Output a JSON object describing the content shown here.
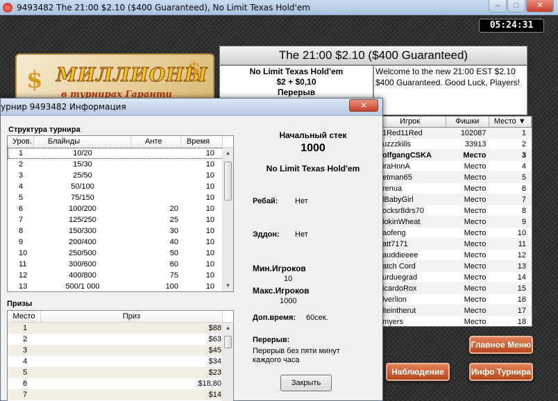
{
  "window": {
    "title": "9493482 The 21:00 $2.10 ($400 Guaranteed), No Limit Texas Hold'em",
    "minimize": "–",
    "maximize": "□",
    "close": "✕"
  },
  "clock": "05:24:31",
  "logo": {
    "main": "МИЛЛИОНЫ",
    "sub": "в турнирах Гаранти"
  },
  "tournament": {
    "header": "The 21:00 $2.10 ($400 Guaranteed)",
    "game": "No Limit Texas Hold'em",
    "buyin": "$2 + $0,10",
    "status": "Перерыв",
    "welcome": "Welcome to the new 21:00 EST $2.10 $400 Guaranteed. Good Luck, Players!"
  },
  "players": {
    "headers": {
      "name": "Игрок",
      "chips": "Фишки",
      "place": "Место ▼"
    },
    "rows": [
      {
        "name": "1Red11Red",
        "chips": "102087",
        "place": "1"
      },
      {
        "name": "uzzzkills",
        "chips": "33913",
        "place": "2"
      },
      {
        "name": "olfgangCSKA",
        "chips": "Место",
        "place": "3"
      },
      {
        "name": "iraHnnA",
        "chips": "Место",
        "place": "4"
      },
      {
        "name": "etman65",
        "chips": "Место",
        "place": "5"
      },
      {
        "name": "renua",
        "chips": "Место",
        "place": "6"
      },
      {
        "name": "lBabyGirl",
        "chips": "Место",
        "place": "7"
      },
      {
        "name": "ocksr8drs70",
        "chips": "Место",
        "place": "8"
      },
      {
        "name": "lokinWheat",
        "chips": "Место",
        "place": "9"
      },
      {
        "name": "aofeng",
        "chips": "Место",
        "place": "10"
      },
      {
        "name": "att7171",
        "chips": "Место",
        "place": "11"
      },
      {
        "name": "auddieeee",
        "chips": "Место",
        "place": "12"
      },
      {
        "name": "atch Cord",
        "chips": "Место",
        "place": "13"
      },
      {
        "name": "urduegrad",
        "chips": "Место",
        "place": "14"
      },
      {
        "name": "icardoRox",
        "chips": "Место",
        "place": "15"
      },
      {
        "name": "lverlion",
        "chips": "Место",
        "place": "16"
      },
      {
        "name": "lteintherut",
        "chips": "Место",
        "place": "17"
      },
      {
        "name": "myers",
        "chips": "Место",
        "place": "18"
      }
    ]
  },
  "buttons": {
    "main_menu": "Главное Меню",
    "observe": "Наблюдение",
    "tourney_info": "Инфо Турнира"
  },
  "dialog": {
    "title": "урнир 9493482 Информация",
    "close_icon": "✕",
    "structure": {
      "title": "Структура турнира",
      "headers": {
        "level": "Уров.",
        "blinds": "Блайнды",
        "ante": "Анте",
        "time": "Время"
      },
      "rows": [
        {
          "level": "1",
          "blinds": "10/20",
          "ante": "",
          "time": "10"
        },
        {
          "level": "2",
          "blinds": "15/30",
          "ante": "",
          "time": "10"
        },
        {
          "level": "3",
          "blinds": "25/50",
          "ante": "",
          "time": "10"
        },
        {
          "level": "4",
          "blinds": "50/100",
          "ante": "",
          "time": "10"
        },
        {
          "level": "5",
          "blinds": "75/150",
          "ante": "",
          "time": "10"
        },
        {
          "level": "6",
          "blinds": "100/200",
          "ante": "20",
          "time": "10"
        },
        {
          "level": "7",
          "blinds": "125/250",
          "ante": "25",
          "time": "10"
        },
        {
          "level": "8",
          "blinds": "150/300",
          "ante": "30",
          "time": "10"
        },
        {
          "level": "9",
          "blinds": "200/400",
          "ante": "40",
          "time": "10"
        },
        {
          "level": "10",
          "blinds": "250/500",
          "ante": "50",
          "time": "10"
        },
        {
          "level": "11",
          "blinds": "300/600",
          "ante": "60",
          "time": "10"
        },
        {
          "level": "12",
          "blinds": "400/800",
          "ante": "75",
          "time": "10"
        },
        {
          "level": "13",
          "blinds": "500/1 000",
          "ante": "100",
          "time": "10"
        }
      ]
    },
    "prizes": {
      "title": "Призы",
      "headers": {
        "place": "Место",
        "prize": "Приз"
      },
      "rows": [
        {
          "place": "1",
          "prize": "$88"
        },
        {
          "place": "2",
          "prize": "$63"
        },
        {
          "place": "3",
          "prize": "$45"
        },
        {
          "place": "4",
          "prize": "$34"
        },
        {
          "place": "5",
          "prize": "$23"
        },
        {
          "place": "6",
          "prize": "$18,80"
        },
        {
          "place": "7",
          "prize": "$14"
        }
      ]
    },
    "info": {
      "start_stack_label": "Начальный стек",
      "start_stack": "1000",
      "game": "No Limit Texas Hold'em",
      "rebuy_label": "Ребай:",
      "rebuy": "Нет",
      "addon_label": "Эддон:",
      "addon": "Нет",
      "min_players_label": "Мин.Игроков",
      "min_players": "10",
      "max_players_label": "Макс.Игроков",
      "max_players": "1000",
      "extra_time_label": "Доп.время:",
      "extra_time": "60сек.",
      "breaks_label": "Перерыв:",
      "breaks": "Перерыв без пяти минут каждого часа"
    },
    "close_button": "Закрыть"
  }
}
